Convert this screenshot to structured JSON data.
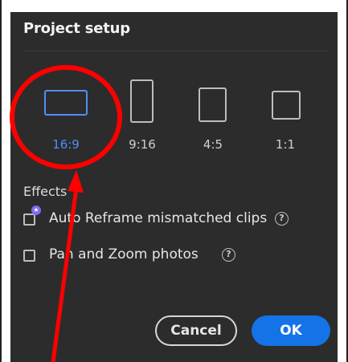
{
  "dialog": {
    "title": "Project setup",
    "ratios": [
      {
        "label": "16:9",
        "selected": true
      },
      {
        "label": "9:16",
        "selected": false
      },
      {
        "label": "4:5",
        "selected": false
      },
      {
        "label": "1:1",
        "selected": false
      }
    ],
    "effects_label": "Effects",
    "options": [
      {
        "label": "Auto Reframe mismatched clips",
        "checked": false,
        "help": "?"
      },
      {
        "label": "Pan and Zoom photos",
        "checked": false,
        "help": "?"
      }
    ],
    "cancel_label": "Cancel",
    "ok_label": "OK"
  },
  "colors": {
    "dialog_bg": "#2c2c2c",
    "accent": "#4f8ff7",
    "primary_button": "#1473e6",
    "annotation": "#ff0000"
  },
  "icons": {
    "sparkle": "star-badge-icon",
    "help": "question-circle-icon"
  }
}
